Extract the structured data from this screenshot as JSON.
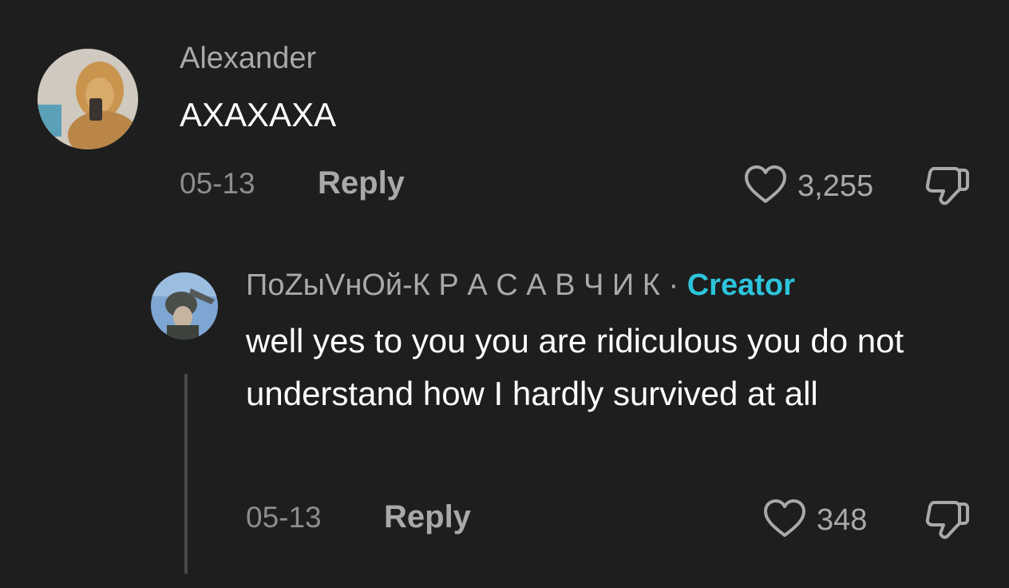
{
  "comments": [
    {
      "username": "Alexander",
      "text": "АХАХАХА",
      "date": "05-13",
      "reply_label": "Reply",
      "likes": "3,255",
      "avatar_icon": "lion-photo"
    }
  ],
  "replies": [
    {
      "username": "ПоZыVнОй-К Р А С А В Ч И К",
      "separator": "·",
      "badge": "Creator",
      "text": "well yes to you you are ridiculous you do not understand how I hardly survived at all",
      "date": "05-13",
      "reply_label": "Reply",
      "likes": "348",
      "avatar_icon": "soldier-photo"
    }
  ],
  "colors": {
    "background": "#1e1e1e",
    "creator_badge": "#2cc4dc",
    "muted_text": "#a9a9a9"
  }
}
